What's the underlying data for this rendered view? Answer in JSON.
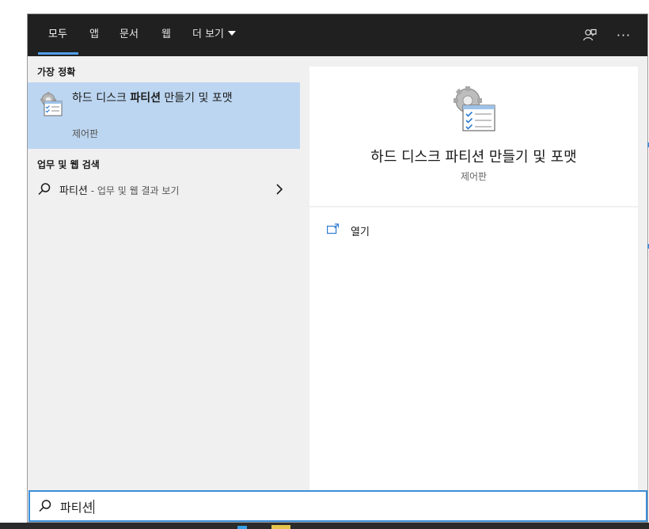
{
  "tabs": [
    {
      "label": "모두",
      "active": true
    },
    {
      "label": "앱",
      "active": false
    },
    {
      "label": "문서",
      "active": false
    },
    {
      "label": "웹",
      "active": false
    },
    {
      "label": "더 보기",
      "active": false
    }
  ],
  "topbar_icons": [
    "feedback-icon",
    "more-options-icon"
  ],
  "more_options_glyph": "···",
  "best_match": {
    "section_title": "가장 정확",
    "title_prefix": "하드 디스크 ",
    "title_bold": "파티션",
    "title_suffix": " 만들기 및 포맷",
    "subtitle": "제어판",
    "icon": "control-panel-settings-icon"
  },
  "web_section": {
    "section_title": "업무 및 웹 검색",
    "query": "파티션",
    "suffix": " - 업무 및 웹 결과 보기"
  },
  "detail": {
    "title": "하드 디스크 파티션 만들기 및 포맷",
    "subtitle": "제어판",
    "actions": [
      {
        "label": "열기",
        "icon": "open-window-icon"
      }
    ]
  },
  "search": {
    "value": "파티션"
  },
  "colors": {
    "topbar": "#202020",
    "accent": "#4f9ee8",
    "selection": "#bcd6f1",
    "search_border": "#3b8fd9"
  }
}
